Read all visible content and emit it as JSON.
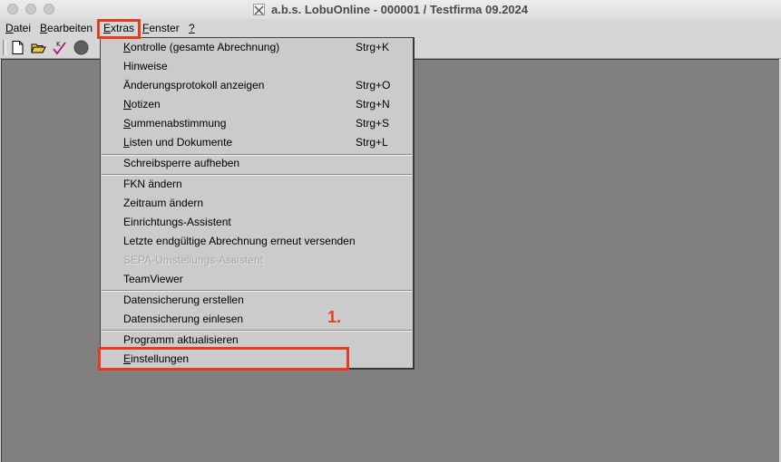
{
  "window": {
    "title": "a.b.s. LobuOnline -  000001 / Testfirma 09.2024"
  },
  "menubar": {
    "items": [
      {
        "label": "Datei",
        "underline": "D",
        "rest": "atei"
      },
      {
        "label": "Bearbeiten",
        "underline": "B",
        "rest": "earbeiten"
      },
      {
        "label": "Extras",
        "underline": "E",
        "rest": "xtras"
      },
      {
        "label": "Fenster",
        "underline": "F",
        "rest": "enster"
      },
      {
        "label": "?",
        "underline": "?",
        "rest": ""
      }
    ]
  },
  "toolbar": {
    "icons": [
      "new-document-icon",
      "open-folder-icon",
      "check-icon",
      "record-icon"
    ]
  },
  "extras_menu": {
    "groups": [
      [
        {
          "label": "Kontrolle (gesamte Abrechnung)",
          "u": "K",
          "rest": "ontrolle (gesamte Abrechnung)",
          "shortcut": "Strg+K",
          "enabled": true
        },
        {
          "label": "Hinweise",
          "u": "",
          "rest": "Hinweise",
          "shortcut": "",
          "enabled": true
        },
        {
          "label": "Änderungsprotokoll anzeigen",
          "u": "",
          "rest": "Änderungsprotokoll anzeigen",
          "shortcut": "Strg+O",
          "enabled": true
        },
        {
          "label": "Notizen",
          "u": "N",
          "rest": "otizen",
          "shortcut": "Strg+N",
          "enabled": true
        },
        {
          "label": "Summenabstimmung",
          "u": "S",
          "rest": "ummenabstimmung",
          "shortcut": "Strg+S",
          "enabled": true
        },
        {
          "label": "Listen und Dokumente",
          "u": "L",
          "rest": "isten und Dokumente",
          "shortcut": "Strg+L",
          "enabled": true
        }
      ],
      [
        {
          "label": "Schreibsperre aufheben",
          "u": "",
          "rest": "Schreibsperre aufheben",
          "shortcut": "",
          "enabled": true
        }
      ],
      [
        {
          "label": "FKN ändern",
          "u": "",
          "rest": "FKN ändern",
          "shortcut": "",
          "enabled": true
        },
        {
          "label": "Zeitraum ändern",
          "u": "",
          "rest": "Zeitraum ändern",
          "shortcut": "",
          "enabled": true
        },
        {
          "label": "Einrichtungs-Assistent",
          "u": "",
          "rest": "Einrichtungs-Assistent",
          "shortcut": "",
          "enabled": true
        },
        {
          "label": "Letzte endgültige Abrechnung erneut versenden",
          "u": "",
          "rest": "Letzte endgültige Abrechnung erneut versenden",
          "shortcut": "",
          "enabled": true
        },
        {
          "label": "SEPA-Umstellungs-Assistent",
          "u": "",
          "rest": "SEPA-Umstellungs-Assistent",
          "shortcut": "",
          "enabled": false
        },
        {
          "label": "TeamViewer",
          "u": "",
          "rest": "TeamViewer",
          "shortcut": "",
          "enabled": true
        }
      ],
      [
        {
          "label": "Datensicherung erstellen",
          "u": "",
          "rest": "Datensicherung erstellen",
          "shortcut": "",
          "enabled": true
        },
        {
          "label": "Datensicherung einlesen",
          "u": "",
          "rest": "Datensicherung einlesen",
          "shortcut": "",
          "enabled": true
        }
      ],
      [
        {
          "label": "Programm aktualisieren",
          "u": "",
          "rest": "Programm aktualisieren",
          "shortcut": "",
          "enabled": true
        },
        {
          "label": "Einstellungen",
          "u": "E",
          "rest": "instellungen",
          "shortcut": "",
          "enabled": true
        }
      ]
    ]
  },
  "annotation": {
    "step_label": "1.",
    "color": "#e83a20"
  }
}
